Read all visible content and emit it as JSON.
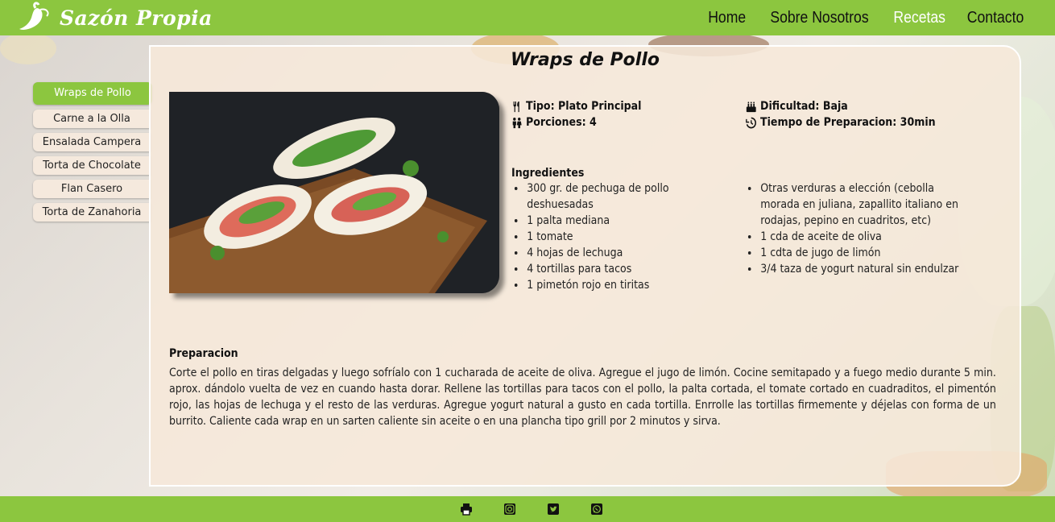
{
  "brand": {
    "name": "Sazón Propia",
    "logo_icon": "chili-pepper-icon"
  },
  "nav": [
    {
      "label": "Home",
      "active": false
    },
    {
      "label": "Sobre Nosotros",
      "active": false
    },
    {
      "label": "Recetas",
      "active": true
    },
    {
      "label": "Contacto",
      "active": false
    }
  ],
  "sidebar": {
    "items": [
      {
        "label": "Wraps de Pollo",
        "active": true
      },
      {
        "label": "Carne a la Olla"
      },
      {
        "label": "Ensalada Campera"
      },
      {
        "label": "Torta de Chocolate"
      },
      {
        "label": "Flan Casero"
      },
      {
        "label": "Torta de Zanahoria"
      }
    ]
  },
  "recipe": {
    "title": "Wraps de Pollo",
    "tipo": "Tipo: Plato Principal",
    "porciones": "Porciones: 4",
    "dificultad": "Dificultad: Baja",
    "tiempo": "Tiempo de Preparacion: 30min",
    "ingredients_title": "Ingredientes",
    "ingredients_col1": [
      "300 gr. de pechuga de pollo deshuesadas",
      "1 palta mediana",
      "1 tomate",
      "4 hojas de lechuga",
      "4 tortillas para tacos",
      "1 pimetón rojo en tiritas"
    ],
    "ingredients_col2": [
      "Otras verduras a elección (cebolla morada en juliana, zapallito italiano en rodajas, pepino en cuadritos, etc)",
      "1 cda de aceite de oliva",
      "1 cdta de jugo de limón",
      "3/4 taza de yogurt natural sin endulzar"
    ],
    "prep_title": "Preparacion",
    "prep_text": "Corte el pollo en tiras delgadas y luego sofríalo con 1 cucharada de aceite de oliva. Agregue el jugo de limón. Cocine semitapado y a fuego medio durante 5 min. aprox. dándolo vuelta de vez en cuando hasta dorar. Rellene las tortillas para tacos con el pollo, la palta cortada, el tomate cortado en cuadraditos, el pimentón rojo, las hojas de lechuga y el resto de las verduras. Agregue yogurt natural a gusto en cada tortilla. Enrrolle las tortillas firmemente y déjelas con forma de un burrito. Caliente cada wrap en un sarten caliente sin aceite o en una plancha tipo grill por 2 minutos y sirva."
  },
  "footer_icons": [
    "print-icon",
    "instagram-icon",
    "twitter-icon",
    "whatsapp-icon"
  ],
  "colors": {
    "accent": "#8cc63f",
    "card": "#f6e8da",
    "text": "#111111"
  }
}
